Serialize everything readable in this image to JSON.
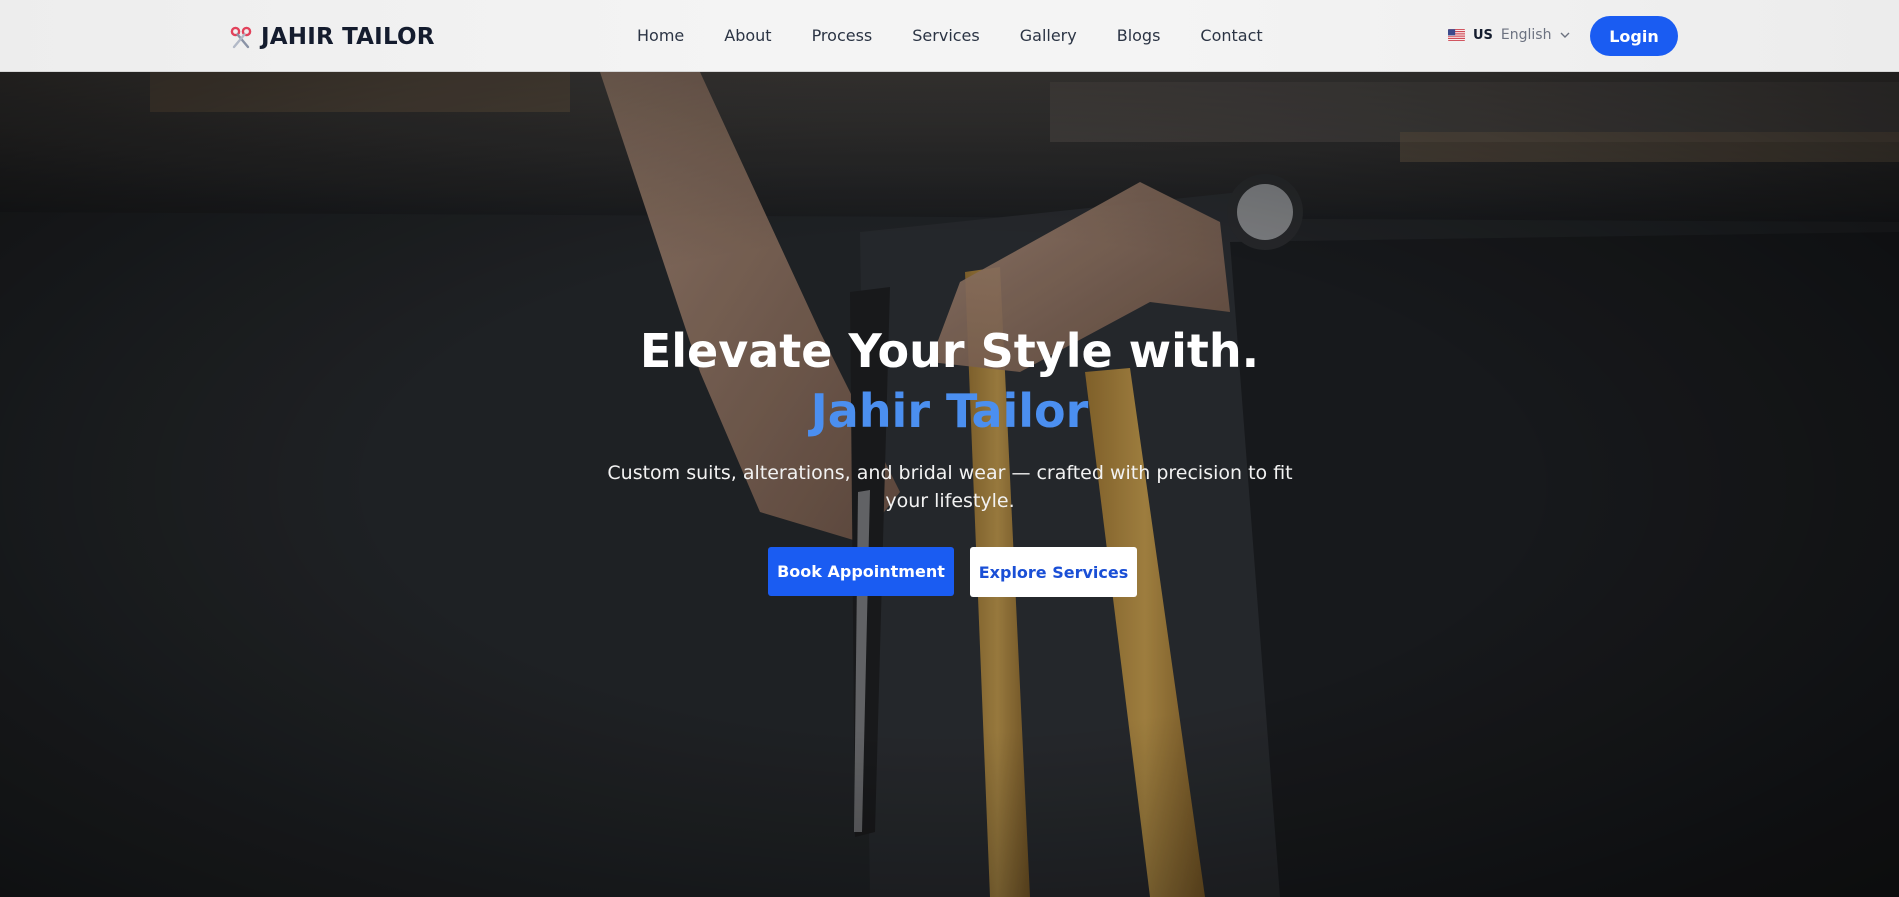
{
  "header": {
    "brand_name": "JAHIR TAILOR",
    "brand_icon": "scissors-icon",
    "nav": [
      "Home",
      "About",
      "Process",
      "Services",
      "Gallery",
      "Blogs",
      "Contact"
    ],
    "language": {
      "code": "US",
      "name": "English",
      "flag_icon": "us-flag-icon"
    },
    "login_label": "Login"
  },
  "hero": {
    "title_line1": "Elevate Your Style with.",
    "title_line2": "Jahir Tailor",
    "subtitle": "Custom suits, alterations, and bridal wear — crafted with precision to fit your lifestyle.",
    "primary_button": "Book Appointment",
    "secondary_button": "Explore Services"
  },
  "colors": {
    "accent": "#1a5cf2",
    "title_accent": "#4b8ff0",
    "brand_text": "#141c2e"
  }
}
